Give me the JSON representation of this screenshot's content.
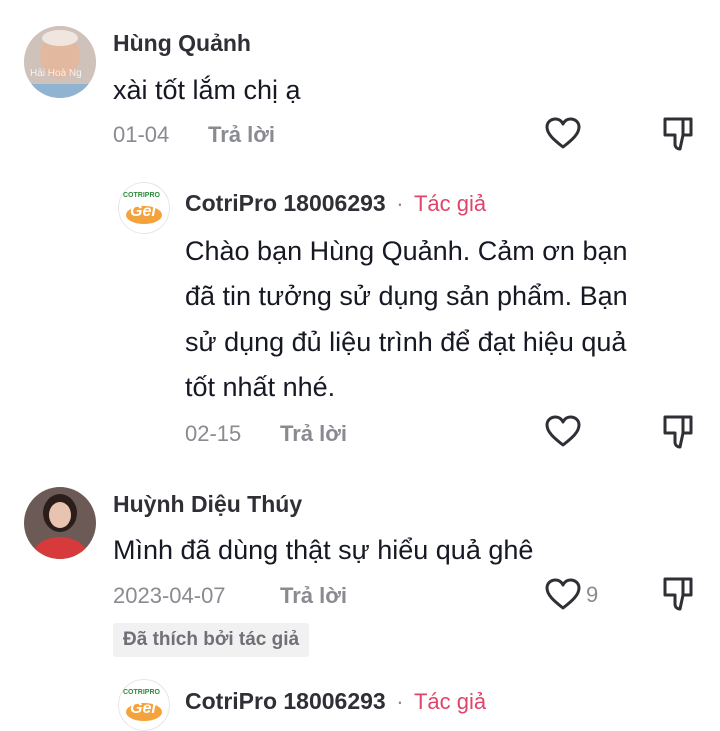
{
  "comments": [
    {
      "user": "Hùng Quảnh",
      "text": "xài tốt lắm chị ạ",
      "date": "01-04",
      "reply_label": "Trả lời",
      "avatar_watermark": "Hải Hoà Ng"
    },
    {
      "user": "CotriPro 18006293",
      "author_tag": "Tác giả",
      "text_lines": [
        "Chào bạn Hùng Quảnh. Cảm ơn bạn",
        "đã tin tưởng sử dụng sản phẩm. Bạn",
        "sử dụng đủ liệu trình để đạt hiệu quả",
        "tốt nhất nhé."
      ],
      "date": "02-15",
      "reply_label": "Trả lời",
      "logo_text_top": "COTRIPRO",
      "logo_text_bottom": "Gel"
    },
    {
      "user": "Huỳnh Diệu Thúy",
      "text": "Mình đã dùng thật sự hiểu quả ghê",
      "date": "2023-04-07",
      "reply_label": "Trả lời",
      "likes": "9",
      "liked_by_author": "Đã thích bởi tác giả"
    },
    {
      "user": "CotriPro 18006293",
      "author_tag": "Tác giả",
      "logo_text_top": "COTRIPRO",
      "logo_text_bottom": "Gel"
    }
  ],
  "separator": "·",
  "colors": {
    "author_tag": "#e0446a",
    "muted": "#8a8b91",
    "text": "#161823"
  },
  "icons": [
    "heart-icon",
    "dislike-icon"
  ]
}
